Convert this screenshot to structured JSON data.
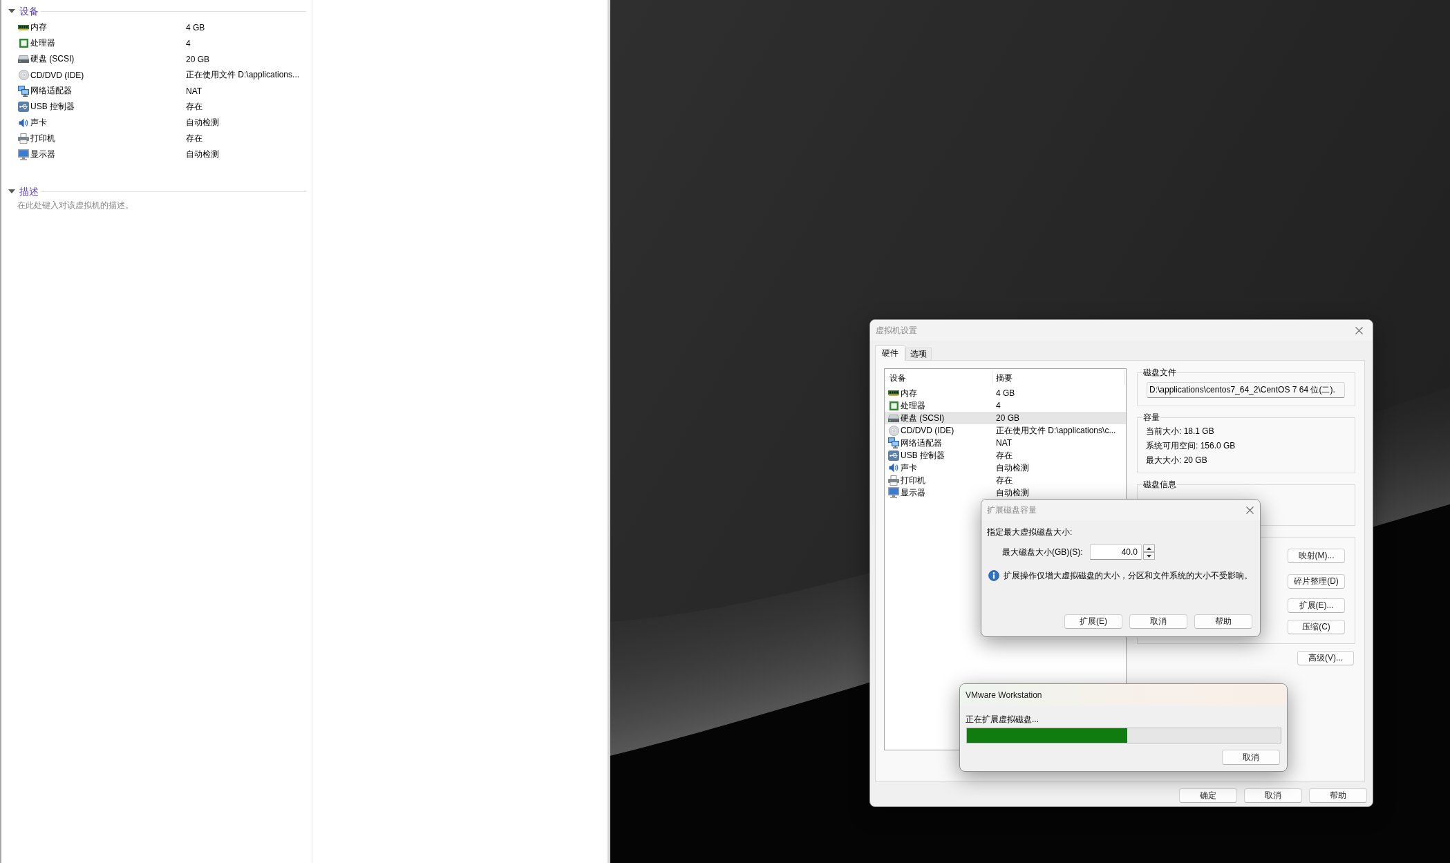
{
  "summary_panel": {
    "sections": [
      {
        "kind": "devices",
        "title": "设备",
        "expanded": true,
        "devices": [
          {
            "kind": "memory",
            "name": "内存",
            "value": "4 GB"
          },
          {
            "kind": "cpu",
            "name": "处理器",
            "value": "4"
          },
          {
            "kind": "disk",
            "name": "硬盘 (SCSI)",
            "value": "20 GB"
          },
          {
            "kind": "cdrom",
            "name": "CD/DVD (IDE)",
            "value": "正在使用文件 D:\\applications..."
          },
          {
            "kind": "network",
            "name": "网络适配器",
            "value": "NAT"
          },
          {
            "kind": "usb",
            "name": "USB 控制器",
            "value": "存在"
          },
          {
            "kind": "sound",
            "name": "声卡",
            "value": "自动检测"
          },
          {
            "kind": "printer",
            "name": "打印机",
            "value": "存在"
          },
          {
            "kind": "display",
            "name": "显示器",
            "value": "自动检测"
          }
        ]
      },
      {
        "kind": "description",
        "title": "描述",
        "expanded": true,
        "text": "在此处键入对该虚拟机的描述。"
      }
    ]
  },
  "settings_dialog": {
    "title": "虚拟机设置",
    "tabs": [
      {
        "label": "硬件",
        "selected": true
      },
      {
        "label": "选项",
        "selected": false
      }
    ],
    "device_table": {
      "columns": [
        "设备",
        "摘要"
      ],
      "rows": [
        {
          "kind": "memory",
          "device": "内存",
          "summary": "4 GB",
          "selected": false
        },
        {
          "kind": "cpu",
          "device": "处理器",
          "summary": "4",
          "selected": false
        },
        {
          "kind": "disk",
          "device": "硬盘 (SCSI)",
          "summary": "20 GB",
          "selected": true
        },
        {
          "kind": "cdrom",
          "device": "CD/DVD (IDE)",
          "summary": "正在使用文件 D:\\applications\\c...",
          "selected": false
        },
        {
          "kind": "network",
          "device": "网络适配器",
          "summary": "NAT",
          "selected": false
        },
        {
          "kind": "usb",
          "device": "USB 控制器",
          "summary": "存在",
          "selected": false
        },
        {
          "kind": "sound",
          "device": "声卡",
          "summary": "自动检测",
          "selected": false
        },
        {
          "kind": "printer",
          "device": "打印机",
          "summary": "存在",
          "selected": false
        },
        {
          "kind": "display",
          "device": "显示器",
          "summary": "自动检测",
          "selected": false
        }
      ]
    },
    "disk_file": {
      "title": "磁盘文件",
      "path": "D:\\applications\\centos7_64_2\\CentOS 7 64 位(二)."
    },
    "capacity": {
      "title": "容量",
      "lines": [
        "当前大小: 18.1 GB",
        "系统可用空间: 156.0 GB",
        "最大大小: 20 GB"
      ]
    },
    "disk_info": {
      "title": "磁盘信息"
    },
    "utility_buttons": [
      "映射(M)...",
      "碎片整理(D)",
      "扩展(E)...",
      "压缩(C)"
    ],
    "advanced_button": "高级(V)...",
    "buttons": [
      "确定",
      "取消",
      "帮助"
    ]
  },
  "expand_dialog": {
    "title": "扩展磁盘容量",
    "prompt": "指定最大虚拟磁盘大小:",
    "size_field": {
      "label": "最大磁盘大小(GB)(S):",
      "value": "40.0"
    },
    "info": "扩展操作仅增大虚拟磁盘的大小，分区和文件系统的大小不受影响。",
    "buttons": [
      "扩展(E)",
      "取消",
      "帮助"
    ]
  },
  "progress_dialog": {
    "title": "VMware Workstation",
    "message": "正在扩展虚拟磁盘...",
    "level": 0.51,
    "buttons": [
      "取消"
    ]
  }
}
